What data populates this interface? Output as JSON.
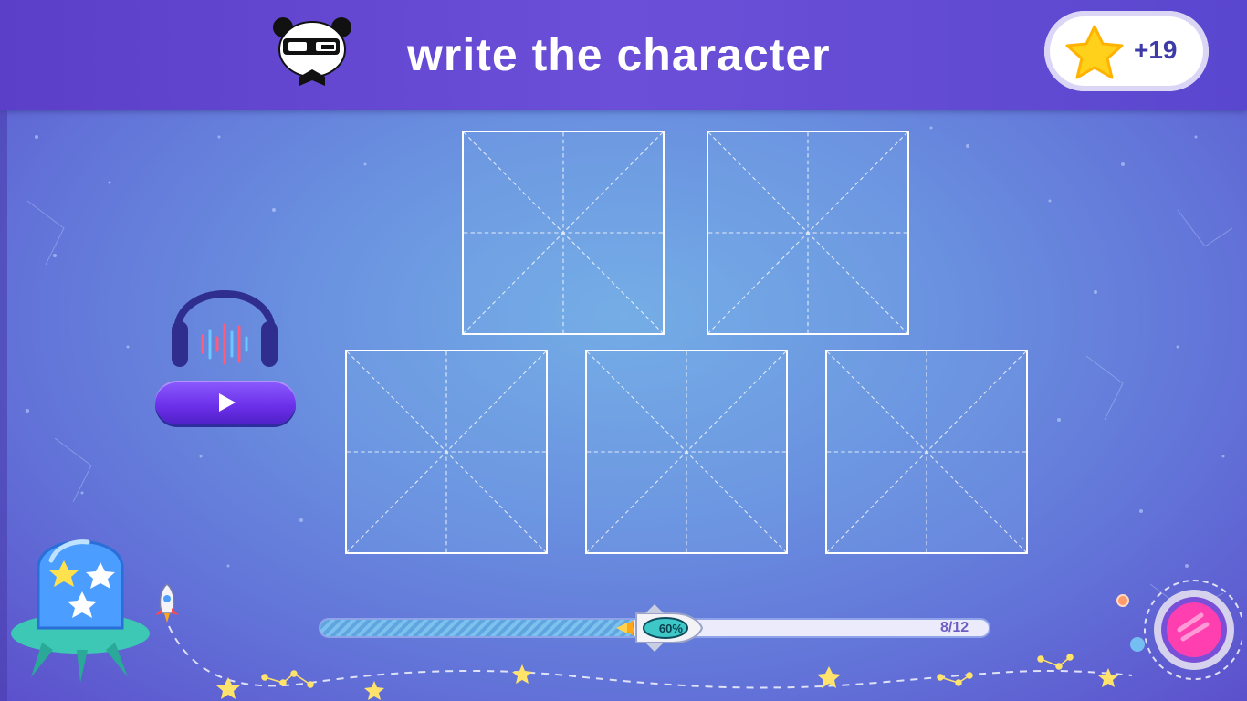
{
  "header": {
    "title": "write the character",
    "score": "+19"
  },
  "audio": {
    "play_icon": "play-icon",
    "headphones_icon": "headphones-icon"
  },
  "grid_boxes": [
    {
      "id": 1
    },
    {
      "id": 2
    },
    {
      "id": 3
    },
    {
      "id": 4
    },
    {
      "id": 5
    }
  ],
  "progress": {
    "percent_label": "60%",
    "fill_fraction": 0.47,
    "count": "8/12"
  },
  "colors": {
    "accent": "#6a2fe8",
    "star": "#ffd11a",
    "portal": "#ff3fb0"
  }
}
